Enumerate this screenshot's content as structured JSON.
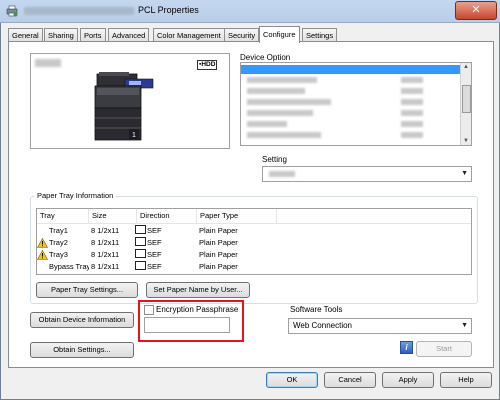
{
  "window": {
    "title": "PCL Properties",
    "close_label": "✕"
  },
  "tabs": [
    {
      "label": "General"
    },
    {
      "label": "Sharing"
    },
    {
      "label": "Ports"
    },
    {
      "label": "Advanced"
    },
    {
      "label": "Color Management"
    },
    {
      "label": "Security"
    },
    {
      "label": "Configure",
      "active": true
    },
    {
      "label": "Settings"
    }
  ],
  "preview": {
    "hdd_label": "HDD",
    "tray_number": "1"
  },
  "device_option": {
    "label": "Device Option"
  },
  "setting": {
    "label": "Setting"
  },
  "paper_tray": {
    "group_label": "Paper Tray Information",
    "columns": [
      "Tray",
      "Size",
      "Direction",
      "Paper Type"
    ],
    "rows": [
      {
        "tray": "Tray1",
        "size": "8 1/2x11",
        "direction": "SEF",
        "paper_type": "Plain Paper",
        "warning": false
      },
      {
        "tray": "Tray2",
        "size": "8 1/2x11",
        "direction": "SEF",
        "paper_type": "Plain Paper",
        "warning": true
      },
      {
        "tray": "Tray3",
        "size": "8 1/2x11",
        "direction": "SEF",
        "paper_type": "Plain Paper",
        "warning": true
      },
      {
        "tray": "Bypass Tray",
        "size": "8 1/2x11",
        "direction": "SEF",
        "paper_type": "Plain Paper",
        "warning": false
      }
    ],
    "paper_tray_settings_button": "Paper Tray Settings...",
    "set_paper_name_button": "Set Paper Name by User..."
  },
  "obtain_device_info_button": "Obtain Device Information",
  "obtain_settings_button": "Obtain Settings...",
  "encryption": {
    "checkbox_label": "Encryption Passphrase",
    "checked": false,
    "value": ""
  },
  "software_tools": {
    "label": "Software Tools",
    "selected": "Web Connection",
    "info_icon": "i",
    "start_button": "Start"
  },
  "footer": {
    "ok": "OK",
    "cancel": "Cancel",
    "apply": "Apply",
    "help": "Help"
  }
}
